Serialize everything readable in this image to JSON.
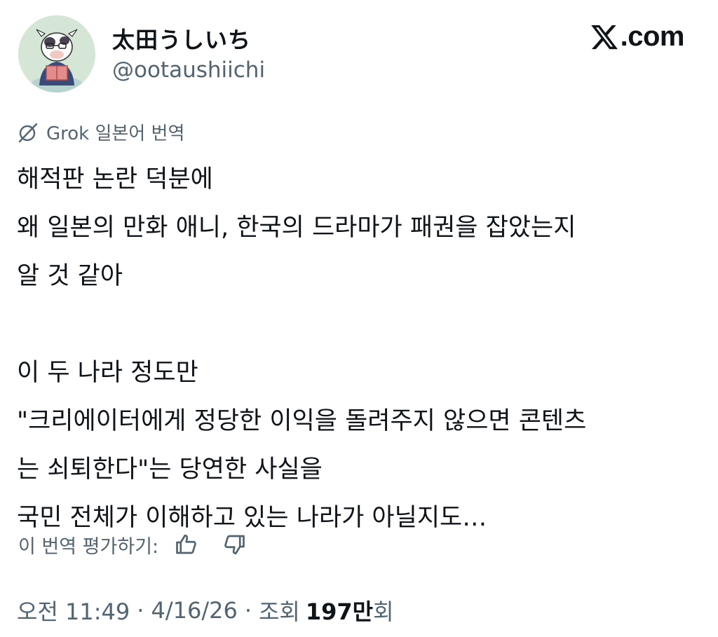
{
  "author": {
    "display_name": "太田うしいち",
    "handle": "@ootaushiichi"
  },
  "brand": {
    "text": ".com",
    "icon": "x-logo-icon"
  },
  "translation": {
    "icon": "grok-icon",
    "label": "Grok 일본어 번역",
    "rate_label": "이 번역 평가하기:",
    "thumbs_up_icon": "thumbs-up-icon",
    "thumbs_down_icon": "thumbs-down-icon"
  },
  "tweet": {
    "lines": [
      "해적판 논란 덕분에",
      "왜 일본의 만화 애니, 한국의 드라마가 패권을 잡았는지",
      "알 것 같아",
      "",
      "이 두 나라 정도만",
      "\"크리에이터에게 정당한 이익을 돌려주지 않으면 콘텐츠",
      "는 쇠퇴한다\"는 당연한 사실을",
      "국민 전체가 이해하고 있는 나라가 아닐지도…"
    ]
  },
  "meta": {
    "time": "오전 11:49",
    "separator": "·",
    "date": "4/16/26",
    "views_label": "조회",
    "views_number": "197만",
    "views_suffix": "회"
  },
  "colors": {
    "text_primary": "#0f1419",
    "text_secondary": "#536471",
    "background": "#ffffff"
  }
}
